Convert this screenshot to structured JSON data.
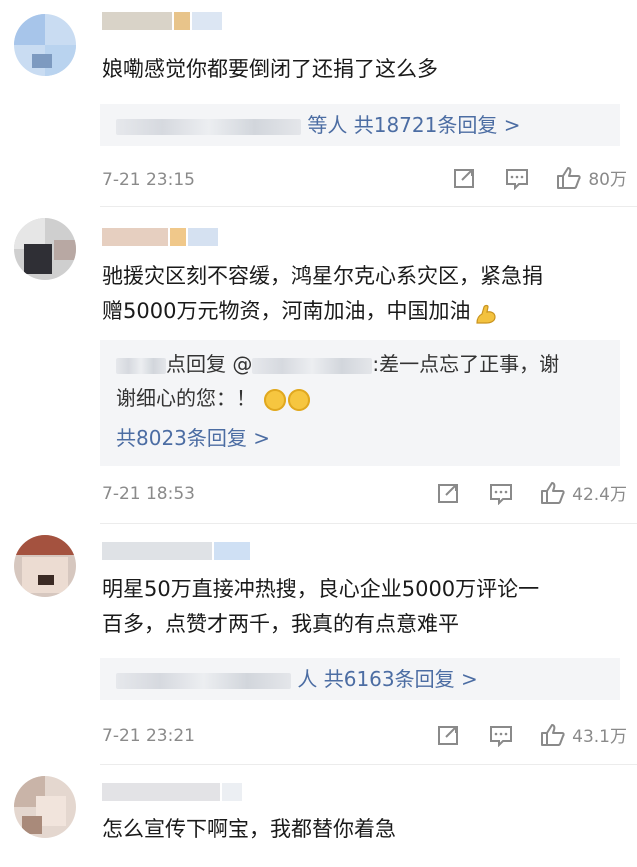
{
  "comments": [
    {
      "text": "娘嘞感觉你都要倒闭了还捐了这么多",
      "reply_summary": "等人 共18721条回复 >",
      "time": "7-21 23:15",
      "likes": "80万"
    },
    {
      "text_line1": "驰援灾区刻不容缓，鸿星尔克心系灾区，紧急捐",
      "text_line2": "赠5000万元物资，河南加油，中国加油",
      "reply_prefix": "点回复 @",
      "reply_text": ":差一点忘了正事，谢",
      "reply_text2": "谢细心的您：！",
      "reply_count": "共8023条回复 >",
      "time": "7-21 18:53",
      "likes": "42.4万"
    },
    {
      "text_line1": "明星50万直接冲热搜，良心企业5000万评论一",
      "text_line2": "百多，点赞才两千，我真的有点意难平",
      "reply_summary": "人 共6163条回复 >",
      "time": "7-21 23:21",
      "likes": "43.1万"
    },
    {
      "text": "怎么宣传下啊宝，我都替你着急"
    }
  ],
  "colors": {
    "link": "#4c6da3",
    "muted": "#8a8a8a",
    "reply_bg": "#f4f5f7"
  },
  "icons": [
    "share-icon",
    "comment-icon",
    "like-icon",
    "strong-arm-emoji",
    "smile-emoji"
  ]
}
